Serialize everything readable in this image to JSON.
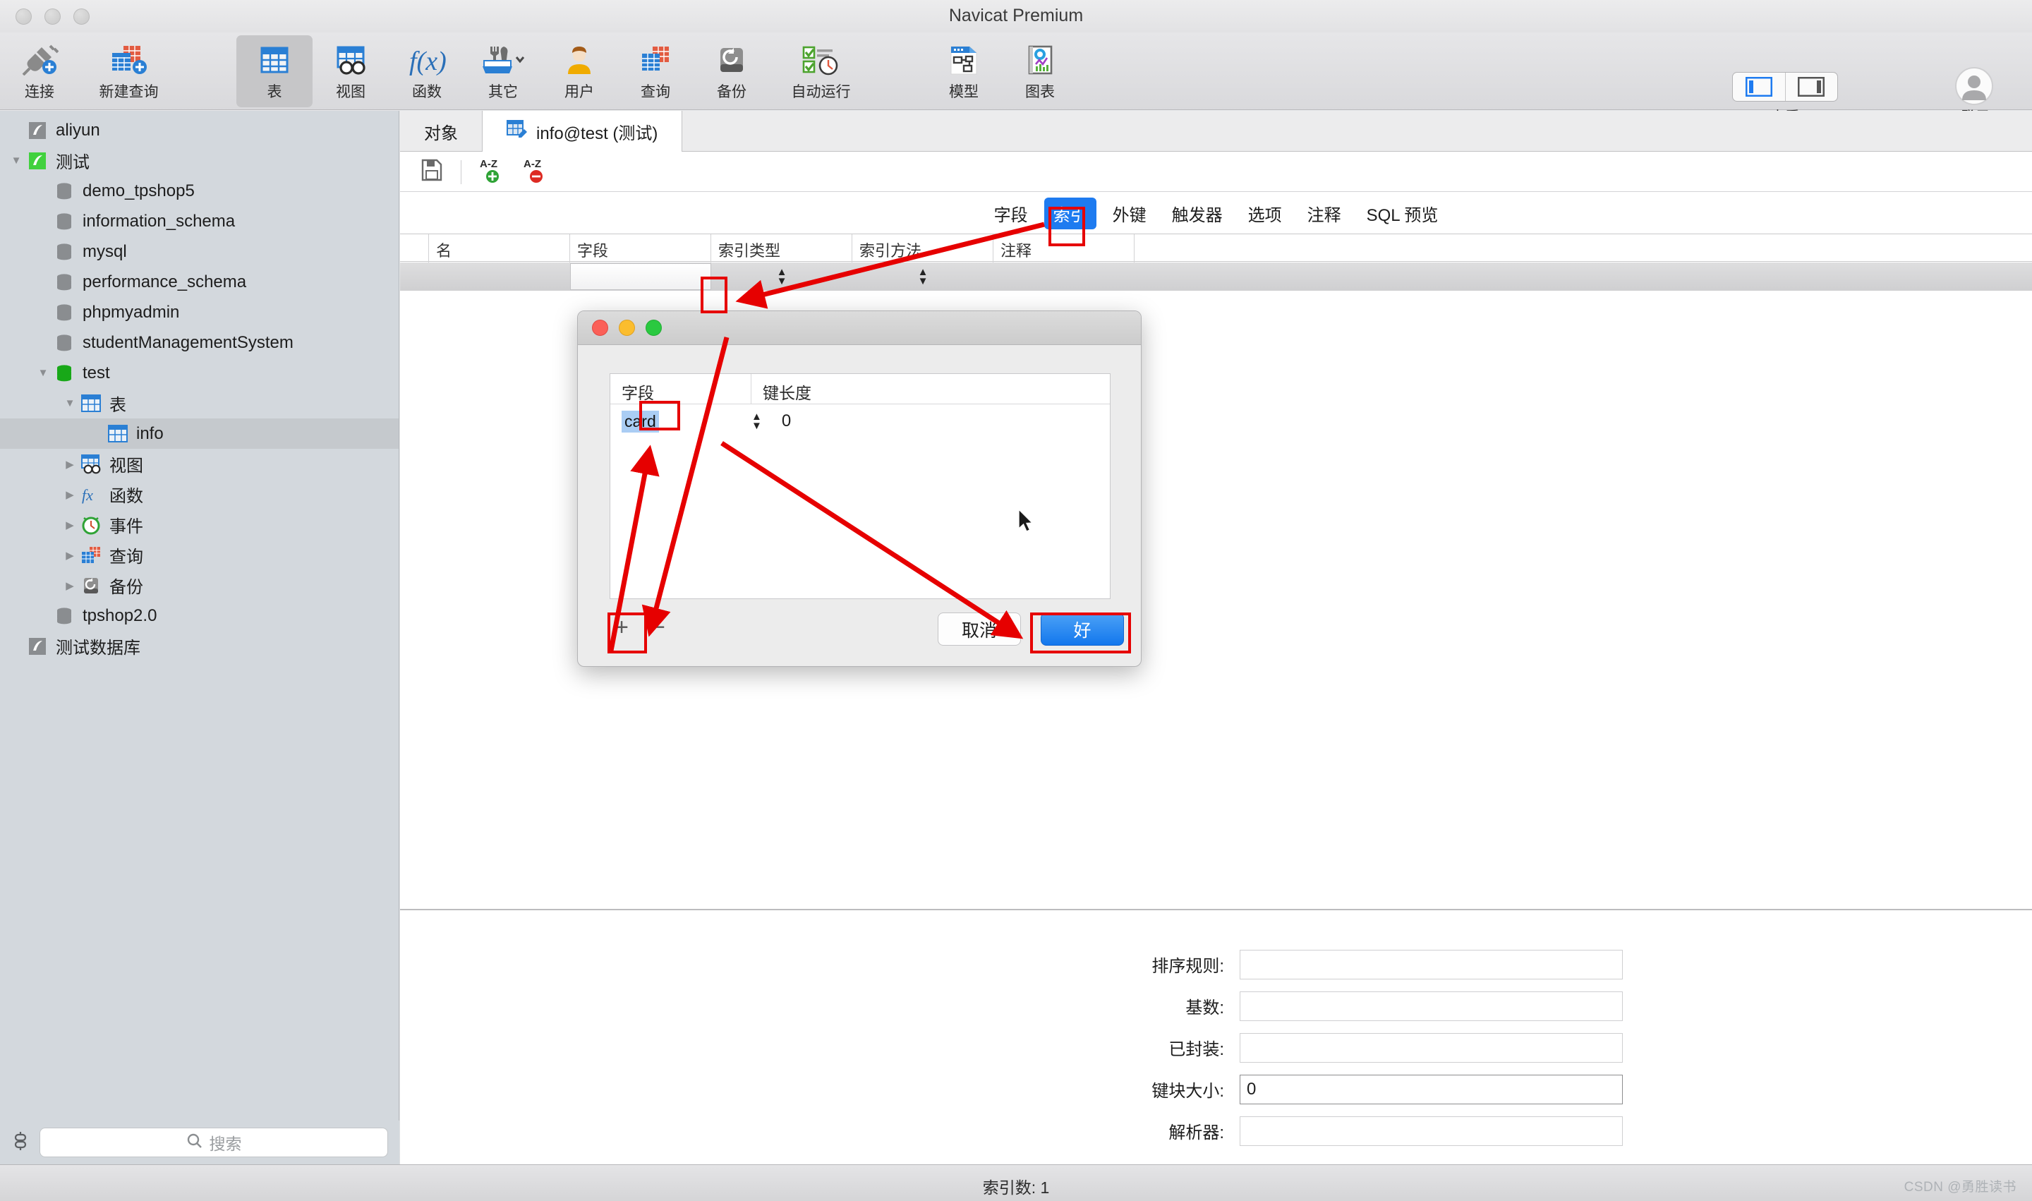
{
  "window": {
    "title": "Navicat Premium"
  },
  "toolbar": {
    "items": [
      {
        "label": "连接",
        "icon": "new-connection-icon"
      },
      {
        "label": "新建查询",
        "icon": "new-query-icon"
      },
      {
        "label": "表",
        "icon": "table-icon"
      },
      {
        "label": "视图",
        "icon": "view-icon"
      },
      {
        "label": "函数",
        "icon": "function-icon"
      },
      {
        "label": "其它",
        "icon": "other-tools-icon"
      },
      {
        "label": "用户",
        "icon": "user-icon"
      },
      {
        "label": "查询",
        "icon": "query-icon"
      },
      {
        "label": "备份",
        "icon": "backup-icon"
      },
      {
        "label": "自动运行",
        "icon": "automation-icon"
      },
      {
        "label": "模型",
        "icon": "model-icon"
      },
      {
        "label": "图表",
        "icon": "chart-icon"
      }
    ],
    "active_index": 2,
    "view_label": "查看",
    "account_label": "登录"
  },
  "sidebar": {
    "search_placeholder": "搜索",
    "tree": [
      {
        "label": "aliyun",
        "icon": "connection-gray-icon",
        "indent": 0,
        "twist": "",
        "selected": false
      },
      {
        "label": "测试",
        "icon": "connection-green-icon",
        "indent": 0,
        "twist": "down",
        "selected": false
      },
      {
        "label": "demo_tpshop5",
        "icon": "database-gray-icon",
        "indent": 1,
        "twist": "",
        "selected": false
      },
      {
        "label": "information_schema",
        "icon": "database-gray-icon",
        "indent": 1,
        "twist": "",
        "selected": false
      },
      {
        "label": "mysql",
        "icon": "database-gray-icon",
        "indent": 1,
        "twist": "",
        "selected": false
      },
      {
        "label": "performance_schema",
        "icon": "database-gray-icon",
        "indent": 1,
        "twist": "",
        "selected": false
      },
      {
        "label": "phpmyadmin",
        "icon": "database-gray-icon",
        "indent": 1,
        "twist": "",
        "selected": false
      },
      {
        "label": "studentManagementSystem",
        "icon": "database-gray-icon",
        "indent": 1,
        "twist": "",
        "selected": false
      },
      {
        "label": "test",
        "icon": "database-green-icon",
        "indent": 1,
        "twist": "down",
        "selected": false
      },
      {
        "label": "表",
        "icon": "table-icon",
        "indent": 2,
        "twist": "down",
        "selected": false
      },
      {
        "label": "info",
        "icon": "table-icon",
        "indent": 3,
        "twist": "",
        "selected": true
      },
      {
        "label": "视图",
        "icon": "view-icon",
        "indent": 2,
        "twist": "right",
        "selected": false
      },
      {
        "label": "函数",
        "icon": "function-icon",
        "indent": 2,
        "twist": "right",
        "selected": false
      },
      {
        "label": "事件",
        "icon": "event-clock-icon",
        "indent": 2,
        "twist": "right",
        "selected": false
      },
      {
        "label": "查询",
        "icon": "query-icon",
        "indent": 2,
        "twist": "right",
        "selected": false
      },
      {
        "label": "备份",
        "icon": "backup-icon",
        "indent": 2,
        "twist": "right",
        "selected": false
      },
      {
        "label": "tpshop2.0",
        "icon": "database-gray-icon",
        "indent": 1,
        "twist": "",
        "selected": false
      },
      {
        "label": "测试数据库",
        "icon": "connection-gray-icon",
        "indent": 0,
        "twist": "",
        "selected": false
      }
    ]
  },
  "main": {
    "tabs": [
      {
        "label": "对象",
        "icon": "",
        "active": false
      },
      {
        "label": "info@test (测试)",
        "icon": "table-edit-icon",
        "active": true
      }
    ],
    "editor_toolbar": [
      {
        "name": "save-icon",
        "label": ""
      },
      {
        "name": "sort-asc-add-icon",
        "label": "A-Z"
      },
      {
        "name": "sort-asc-remove-icon",
        "label": "A-Z"
      }
    ],
    "subtabs": [
      {
        "label": "字段",
        "active": false
      },
      {
        "label": "索引",
        "active": true
      },
      {
        "label": "外键",
        "active": false
      },
      {
        "label": "触发器",
        "active": false
      },
      {
        "label": "选项",
        "active": false
      },
      {
        "label": "注释",
        "active": false
      },
      {
        "label": "SQL 预览",
        "active": false
      }
    ],
    "grid": {
      "columns": [
        "名",
        "字段",
        "索引类型",
        "索引方法",
        "注释"
      ],
      "rows": [
        {
          "名": "",
          "字段": "",
          "索引类型": "",
          "索引方法": "",
          "注释": ""
        }
      ]
    },
    "form": [
      {
        "label": "排序规则:",
        "value": "",
        "strong": false
      },
      {
        "label": "基数:",
        "value": "",
        "strong": false
      },
      {
        "label": "已封装:",
        "value": "",
        "strong": false
      },
      {
        "label": "键块大小:",
        "value": "0",
        "strong": true
      },
      {
        "label": "解析器:",
        "value": "",
        "strong": false
      }
    ]
  },
  "dialog": {
    "columns": [
      "字段",
      "键长度"
    ],
    "rows": [
      {
        "字段": "card",
        "键长度": "0"
      }
    ],
    "add_label": "+",
    "remove_label": "−",
    "cancel_label": "取消",
    "ok_label": "好"
  },
  "statusbar": {
    "text": "索引数: 1",
    "watermark": "CSDN @勇胜读书"
  },
  "colors": {
    "accent_blue": "#1e7bf0",
    "annotation_red": "#e60000",
    "selection_blue": "#aacdf4",
    "sidebar_bg": "#d3d8dd"
  }
}
